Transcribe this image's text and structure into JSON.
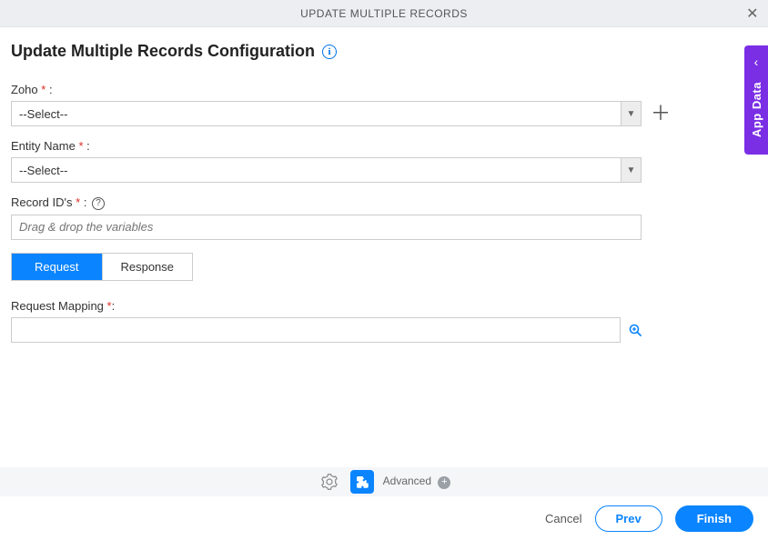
{
  "header": {
    "title": "UPDATE MULTIPLE RECORDS"
  },
  "page": {
    "title": "Update Multiple Records Configuration",
    "info_icon": "i"
  },
  "fields": {
    "zoho": {
      "label": "Zoho",
      "colon": " :",
      "value": "--Select--"
    },
    "entity": {
      "label": "Entity Name",
      "colon": " :",
      "value": "--Select--"
    },
    "record_ids": {
      "label": "Record ID's",
      "colon": " :",
      "placeholder": "Drag & drop the variables",
      "help": "?"
    },
    "request_mapping": {
      "label": "Request Mapping",
      "asterisk_colon": ":"
    }
  },
  "tabs": {
    "request": "Request",
    "response": "Response"
  },
  "toolbar": {
    "advanced": "Advanced"
  },
  "footer": {
    "cancel": "Cancel",
    "prev": "Prev",
    "finish": "Finish"
  },
  "side_tab": {
    "label": "App Data"
  }
}
